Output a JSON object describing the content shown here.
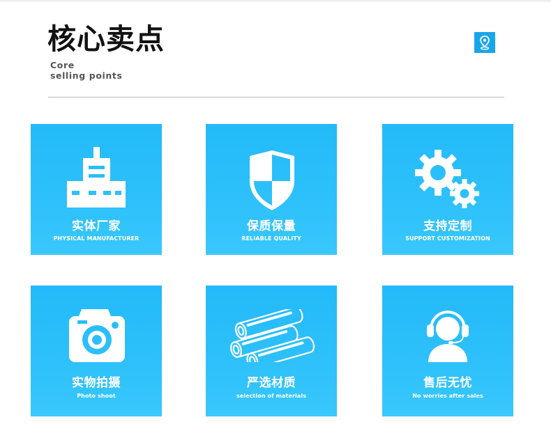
{
  "header": {
    "title": "核心卖点",
    "subtitle_line1": "Core",
    "subtitle_line2": "selling points"
  },
  "colors": {
    "card_top": "#23baf9",
    "card_bottom": "#3ac8fd",
    "badge": "#1aa5e8",
    "divider": "#b8b8b8"
  },
  "features": [
    {
      "cn": "实体厂家",
      "en": "PHYSICAL MANUFACTURER",
      "icon": "factory-icon"
    },
    {
      "cn": "保质保量",
      "en": "RELIABLE QUALITY",
      "icon": "shield-icon"
    },
    {
      "cn": "支持定制",
      "en": "SUPPORT CUSTOMIZATION",
      "icon": "gears-icon"
    },
    {
      "cn": "实物拍摄",
      "en": "Photo shoot",
      "icon": "camera-icon"
    },
    {
      "cn": "严选材质",
      "en": "selection of materials",
      "icon": "pipes-icon"
    },
    {
      "cn": "售后无忧",
      "en": "No worries after sales",
      "icon": "headset-agent-icon"
    }
  ]
}
